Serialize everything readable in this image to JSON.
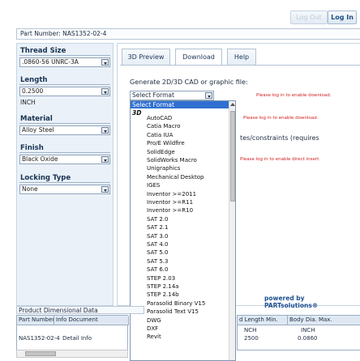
{
  "header": {
    "logout_label": "Log Out",
    "login_label": "Log In",
    "part_number": "Part Number: NAS1352-02-4"
  },
  "params": {
    "thread_size_label": "Thread Size",
    "thread_size_value": ".0860-56 UNRC-3A",
    "length_label": "Length",
    "length_value": "0.2500",
    "length_unit": "INCH",
    "material_label": "Material",
    "material_value": "Alloy Steel",
    "finish_label": "Finish",
    "finish_value": "Black Oxide",
    "locking_label": "Locking Type",
    "locking_value": "None"
  },
  "tabs": [
    {
      "label": "3D Preview"
    },
    {
      "label": "Download"
    },
    {
      "label": "Help"
    }
  ],
  "download": {
    "generate_label": "Generate 2D/3D CAD or graphic file:",
    "select_value": "Select Format",
    "warn_download": "Please log in to enable download.",
    "warn_download2": "Please log in to enable download.",
    "constraints_text": "tes/constraints (requires",
    "warn_insert": "Please log in to enable direct insert."
  },
  "dropdown": {
    "header": "Select Format",
    "group": "3D",
    "items": [
      "AutoCAD",
      "Catia Macro",
      "Catia IUA",
      "Pro/E Wildfire",
      "SolidEdge",
      "SolidWorks Macro",
      "Unigraphics",
      "Mechanical Desktop",
      "IGES",
      "Inventor >=2011",
      "Inventor >=R11",
      "Inventor >=R10",
      "SAT 2.0",
      "SAT 2.1",
      "SAT 3.0",
      "SAT 4.0",
      "SAT 5.0",
      "SAT 5.3",
      "SAT 6.0",
      "STEP 2.03",
      "STEP 2.14a",
      "STEP 2.14b",
      "Parasolid Binary V15",
      "Parasolid Text V15",
      "DWG",
      "DXF",
      "Revit"
    ]
  },
  "bottom": {
    "powered": "powered by PARTsolutions®",
    "table_title": "Product Dimensional Data",
    "col_part": "Part Number",
    "col_info": "Info Document",
    "row_part": "NAS1352-02-4",
    "row_info": "Detail Info",
    "col_thread_len": "d Length Min.",
    "col_body_dia": "Body Dia. Max.",
    "unit_a": "NCH",
    "unit_b": "INCH",
    "val_a": "2500",
    "val_b": "0.0860"
  }
}
